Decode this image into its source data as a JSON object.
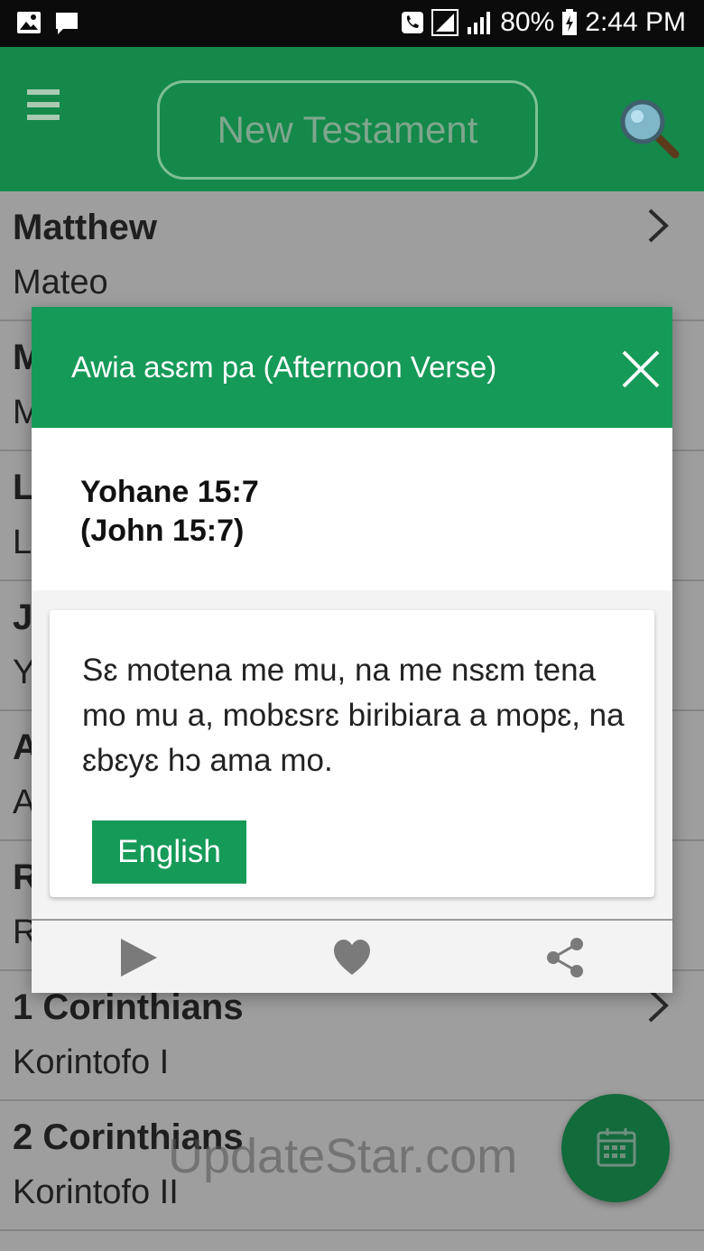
{
  "status_bar": {
    "battery": "80%",
    "time": "2:44 PM"
  },
  "app_bar": {
    "title": "New Testament"
  },
  "books": [
    {
      "english": "Matthew",
      "twi": "Mateo"
    },
    {
      "english": "M",
      "twi": "M"
    },
    {
      "english": "L",
      "twi": "L"
    },
    {
      "english": "J",
      "twi": "Y"
    },
    {
      "english": "A",
      "twi": "A"
    },
    {
      "english": "R",
      "twi": "R"
    },
    {
      "english": "1 Corinthians",
      "twi": "Korintofo I"
    },
    {
      "english": "2 Corinthians",
      "twi": "Korintofo II"
    }
  ],
  "dialog": {
    "title": "Awia asɛm pa (Afternoon Verse)",
    "reference_line1": "Yohane 15:7",
    "reference_line2": "(John 15:7)",
    "verse": "Sɛ motena me mu, na me nsɛm tena mo mu a, mobɛsrɛ biribiara a mopɛ, na ɛbɛyɛ hɔ ama mo.",
    "language_button": "English"
  },
  "watermark": "UpdateStar.com",
  "colors": {
    "app_bar": "#14894a",
    "dialog_header": "#169a57",
    "fab": "#126b3b"
  }
}
